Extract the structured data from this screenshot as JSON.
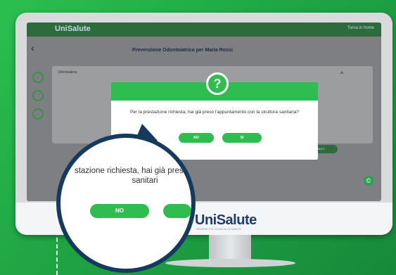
{
  "app": {
    "brand": "UniSalute",
    "top_link": "Torna in home",
    "page_title": "Prevenzione Odontoiatrica per Maria Rossi",
    "card_label": "Odontoiatria",
    "next_button": "AVANTI",
    "chat_icon": "chat-icon"
  },
  "dialog": {
    "icon": "question-mark-icon",
    "icon_glyph": "?",
    "message": "Per la prestazione richiesta, hai già preso l'appuntamento con la struttura sanitaria?",
    "no_label": "NO",
    "yes_label": "SI"
  },
  "magnifier": {
    "text": "stazione richiesta, hai già pres struttura sanitari",
    "no_label": "NO"
  },
  "monitor": {
    "brand": "UniSalute",
    "brand_sub": "SEMPRE PIÙ VICINI ALLA SANITÀ"
  },
  "colors": {
    "accent": "#2fbd4f",
    "navy": "#163a5d"
  }
}
